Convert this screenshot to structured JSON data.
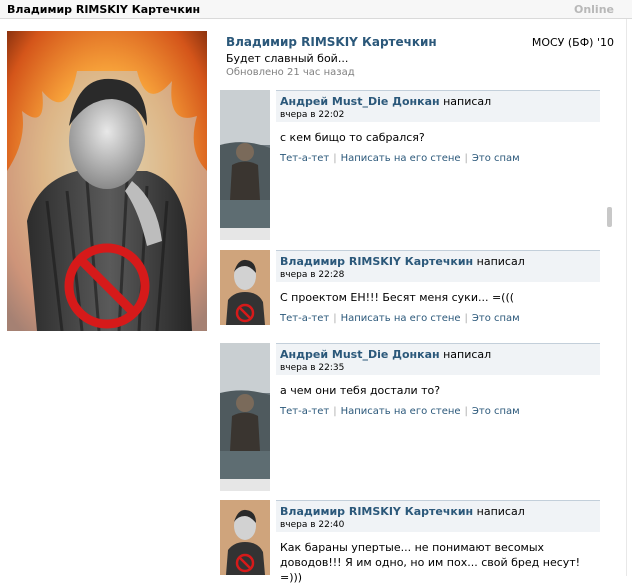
{
  "titlebar": {
    "name": "Владимир RIMSKIY Картечкин",
    "status": "Online"
  },
  "profile": {
    "name": "Владимир RIMSKIY Картечкин",
    "education": "МОСУ (БФ) '10",
    "status_text": "Будет славный бой...",
    "updated": "Обновлено 21 час назад"
  },
  "posts": [
    {
      "author": "Андрей Must_Die Донкан",
      "wrote": "написал",
      "time": "вчера в 22:02",
      "text": "с кем бищо то сабрался?",
      "actions": [
        "Тет-а-тет",
        "Написать на его стене",
        "Это спам"
      ]
    },
    {
      "author": "Владимир RIMSKIY Картечкин",
      "wrote": "написал",
      "time": "вчера в 22:28",
      "text": "С проектом ЕН!!! Бесят меня суки... =(((",
      "actions": [
        "Тет-а-тет",
        "Написать на его стене",
        "Это спам"
      ]
    },
    {
      "author": "Андрей Must_Die Донкан",
      "wrote": "написал",
      "time": "вчера в 22:35",
      "text": "а чем они тебя достали то?",
      "actions": [
        "Тет-а-тет",
        "Написать на его стене",
        "Это спам"
      ]
    },
    {
      "author": "Владимир RIMSKIY Картечкин",
      "wrote": "написал",
      "time": "вчера в 22:40",
      "text": "Как бараны упертые... не понимают весомых доводов!!! Я им одно, но им пох... свой бред несут! =)))",
      "actions": []
    }
  ],
  "colors": {
    "link": "#2b587a",
    "meta_bg": "#f0f3f6",
    "meta_border": "#c3cfda"
  },
  "icons": {
    "no_sign": "no-sign-icon"
  }
}
